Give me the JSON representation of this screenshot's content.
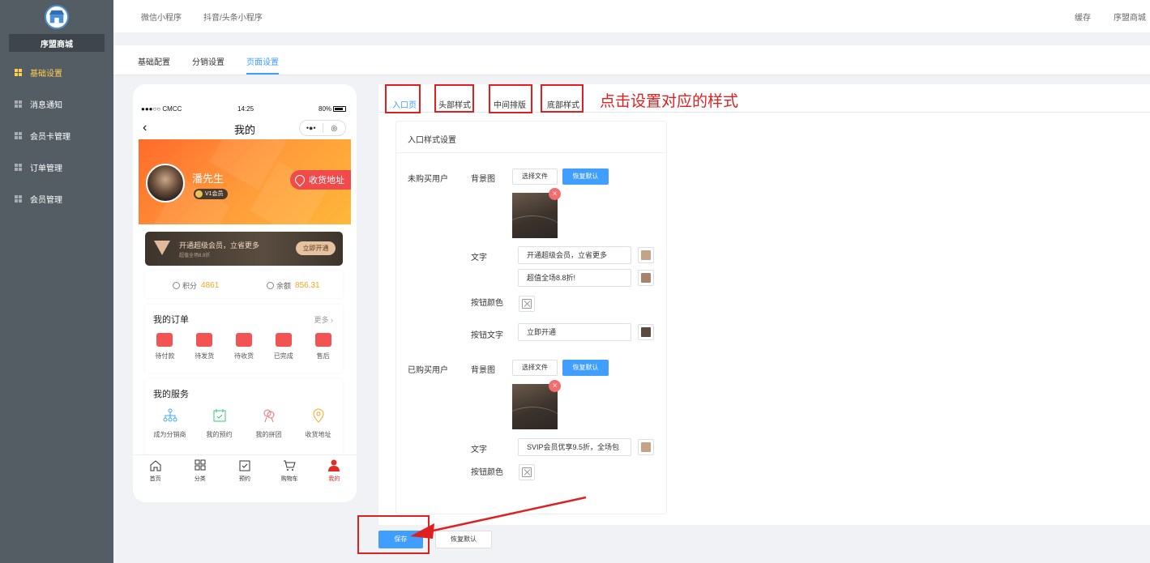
{
  "sidebar": {
    "shop_name": "序盟商城",
    "items": [
      {
        "label": "基础设置",
        "active": true
      },
      {
        "label": "消息通知",
        "active": false
      },
      {
        "label": "会员卡管理",
        "active": false
      },
      {
        "label": "订单管理",
        "active": false
      },
      {
        "label": "会员管理",
        "active": false
      }
    ]
  },
  "topbar": {
    "links": [
      "微信小程序",
      "抖音/头条小程序"
    ],
    "right": [
      "缓存",
      "序盟商城"
    ]
  },
  "subtabs": [
    {
      "label": "基础配置",
      "active": false
    },
    {
      "label": "分销设置",
      "active": false
    },
    {
      "label": "页面设置",
      "active": true
    }
  ],
  "phone": {
    "status": {
      "carrier": "●●●○○ CMCC",
      "time": "14:25",
      "battery": "80%"
    },
    "nav_title": "我的",
    "capsule": [
      "•●•",
      "◎"
    ],
    "user": {
      "name": "潘先生",
      "badge": "V1会员"
    },
    "address_button": "收货地址",
    "vip": {
      "line1": "开通超级会员，立省更多",
      "line2": "超值全场8.8折",
      "button": "立即开通"
    },
    "points": {
      "label": "积分",
      "value": "4861"
    },
    "balance": {
      "label": "余额",
      "value": "856.31"
    },
    "orders": {
      "title": "我的订单",
      "more": "更多",
      "items": [
        "待付款",
        "待发货",
        "待收货",
        "已完成",
        "售后"
      ]
    },
    "services": {
      "title": "我的服务",
      "items": [
        "成为分销商",
        "我的预约",
        "我的拼团",
        "收货地址"
      ]
    },
    "tabbar": [
      {
        "label": "首页",
        "active": false
      },
      {
        "label": "分类",
        "active": false
      },
      {
        "label": "预约",
        "active": false
      },
      {
        "label": "购物车",
        "active": false
      },
      {
        "label": "我的",
        "active": true
      }
    ]
  },
  "style_tabs": [
    {
      "label": "入口页",
      "active": true
    },
    {
      "label": "头部样式",
      "active": false
    },
    {
      "label": "中间排版",
      "active": false
    },
    {
      "label": "底部样式",
      "active": false
    }
  ],
  "hint_text": "点击设置对应的样式",
  "form": {
    "title": "入口样式设置",
    "unpurchased": {
      "section_label": "未购买用户",
      "bg_label": "背景图",
      "choose_file": "选择文件",
      "restore_default": "恢复默认",
      "text_label": "文字",
      "text1": "开通超级会员，立省更多",
      "text2": "超值全场8.8折!",
      "text1_color": "#c4a386",
      "text2_color": "#a8826a",
      "button_color_label": "按钮颜色",
      "button_text_label": "按钮文字",
      "button_text": "立即开通",
      "button_text_color": "#5b4a3e"
    },
    "purchased": {
      "section_label": "已购买用户",
      "bg_label": "背景图",
      "choose_file": "选择文件",
      "restore_default": "恢复默认",
      "text_label": "文字",
      "text1": "SVIP会员优享9.5折，全场包",
      "text1_color": "#c4a386",
      "button_color_label": "按钮颜色"
    }
  },
  "footer": {
    "save": "保存",
    "reset": "恢复默认"
  },
  "accent_color": "#409eff",
  "annotation_color": "#e02020"
}
